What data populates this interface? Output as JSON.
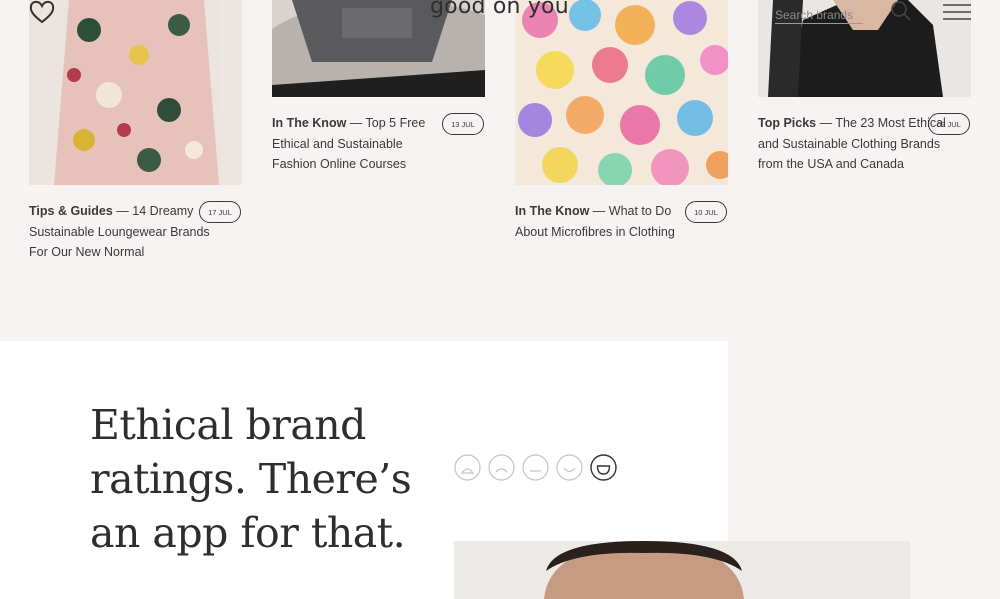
{
  "header": {
    "logo_text": "good on you",
    "search_placeholder": "Search brands"
  },
  "cards": [
    {
      "category": "Tips & Guides",
      "title": "14 Dreamy Sustainable Loungewear Brands For Our New Normal",
      "date": "17 JUL"
    },
    {
      "category": "In The Know",
      "title": "Top 5 Free Ethical and Sustainable Fashion Online Courses",
      "date": "13 JUL"
    },
    {
      "category": "In The Know",
      "title": "What to Do About Microfibres in Clothing",
      "date": "10 JUL"
    },
    {
      "category": "Top Picks",
      "title": "The 23 Most Ethical and Sustainable Clothing Brands from the USA and Canada",
      "date": "03 JUL"
    }
  ],
  "separator": " — ",
  "promo": {
    "title": "Ethical brand ratings. There’s an app for that."
  },
  "rating_faces": [
    "very-sad-face-icon",
    "sad-face-icon",
    "neutral-face-icon",
    "smile-face-icon",
    "happy-face-icon"
  ],
  "colors": {
    "accent": "#2e2e2e",
    "background": "#f7f3f2"
  }
}
